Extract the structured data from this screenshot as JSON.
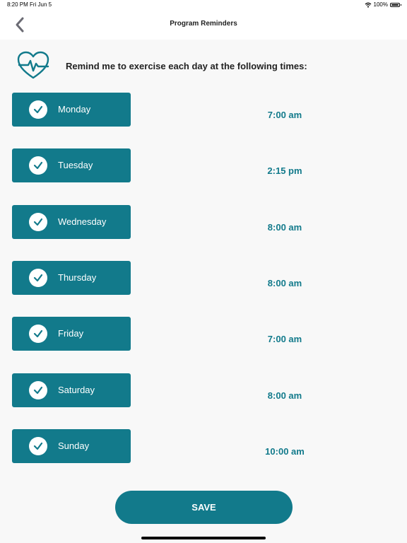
{
  "status_bar": {
    "time": "8:20 PM",
    "date": "Fri Jun 5",
    "battery_text": "100%"
  },
  "nav": {
    "title": "Program Reminders",
    "back_icon": "chevron-left-icon"
  },
  "header": {
    "icon": "heart-pulse-icon",
    "text": "Remind me to exercise each day at the following times:"
  },
  "days": [
    {
      "label": "Monday",
      "time": "7:00 am",
      "checked": true
    },
    {
      "label": "Tuesday",
      "time": "2:15 pm",
      "checked": true
    },
    {
      "label": "Wednesday",
      "time": "8:00 am",
      "checked": true
    },
    {
      "label": "Thursday",
      "time": "8:00 am",
      "checked": true
    },
    {
      "label": "Friday",
      "time": "7:00 am",
      "checked": true
    },
    {
      "label": "Saturday",
      "time": "8:00 am",
      "checked": true
    },
    {
      "label": "Sunday",
      "time": "10:00 am",
      "checked": true
    }
  ],
  "save_label": "SAVE",
  "colors": {
    "accent": "#127a8b",
    "background": "#f8f8f8"
  }
}
